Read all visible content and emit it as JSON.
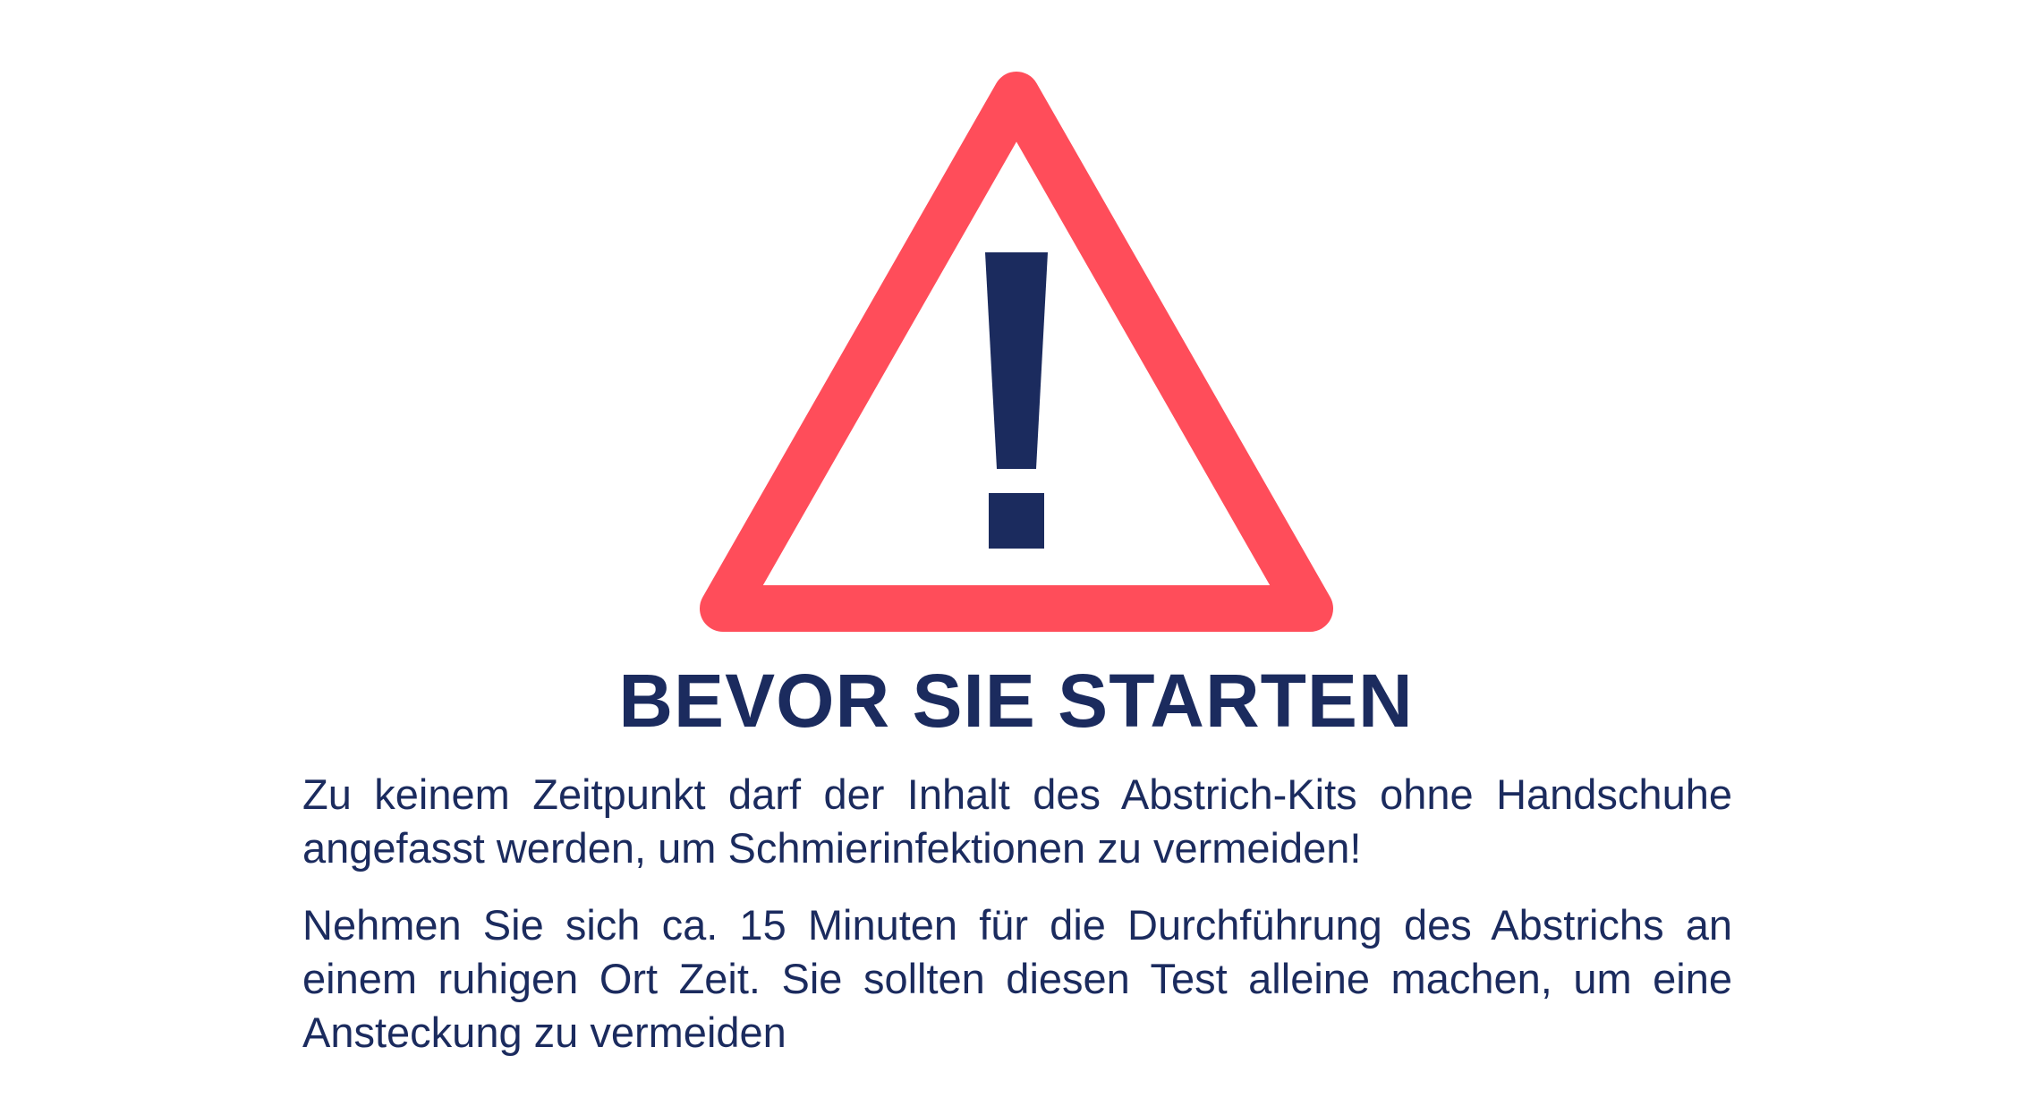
{
  "sign": {
    "icon": "warning-triangle-icon",
    "border_color": "#ff4d5a",
    "mark_color": "#1b2b5e"
  },
  "title": "BEVOR SIE STARTEN",
  "paragraphs": [
    "Zu keinem Zeitpunkt darf der Inhalt des Abstrich-Kits ohne Handschuhe angefasst werden, um Schmierinfektionen zu vermeiden!",
    "Nehmen Sie sich ca. 15 Minuten für die Durchführung des Abstrichs an einem ruhigen Ort Zeit. Sie sollten diesen Test alleine machen, um eine Ansteckung zu vermeiden"
  ],
  "text_color": "#1b2b5e"
}
